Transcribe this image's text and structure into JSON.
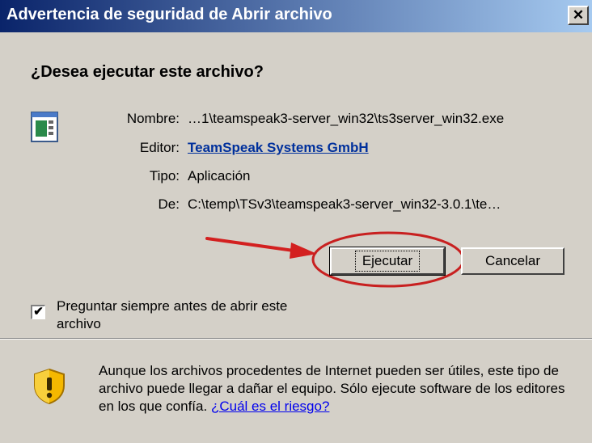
{
  "window": {
    "title": "Advertencia de seguridad de Abrir archivo",
    "close_glyph": "✕"
  },
  "question": "¿Desea ejecutar este archivo?",
  "details": {
    "name_label": "Nombre:",
    "name_value": "…1\\teamspeak3-server_win32\\ts3server_win32.exe",
    "publisher_label": "Editor:",
    "publisher_value": "TeamSpeak Systems GmbH",
    "type_label": "Tipo:",
    "type_value": "Aplicación",
    "from_label": "De:",
    "from_value": "C:\\temp\\TSv3\\teamspeak3-server_win32-3.0.1\\te…"
  },
  "buttons": {
    "run": "Ejecutar",
    "cancel": "Cancelar"
  },
  "checkbox": {
    "label": "Preguntar siempre antes de abrir este archivo",
    "checked": true,
    "mark": "✔"
  },
  "warning": {
    "text": "Aunque los archivos procedentes de Internet pueden ser útiles, este tipo de archivo puede llegar a dañar el equipo. Sólo ejecute software de los editores en los que confía.",
    "link": "¿Cuál es el riesgo?"
  },
  "icons": {
    "file": "application-file-icon",
    "warning": "shield-warning-icon",
    "annotation": "red-arrow"
  },
  "colors": {
    "title_start": "#0a246a",
    "title_end": "#a6caf0",
    "annotation": "#d32020",
    "link": "#00309c"
  }
}
